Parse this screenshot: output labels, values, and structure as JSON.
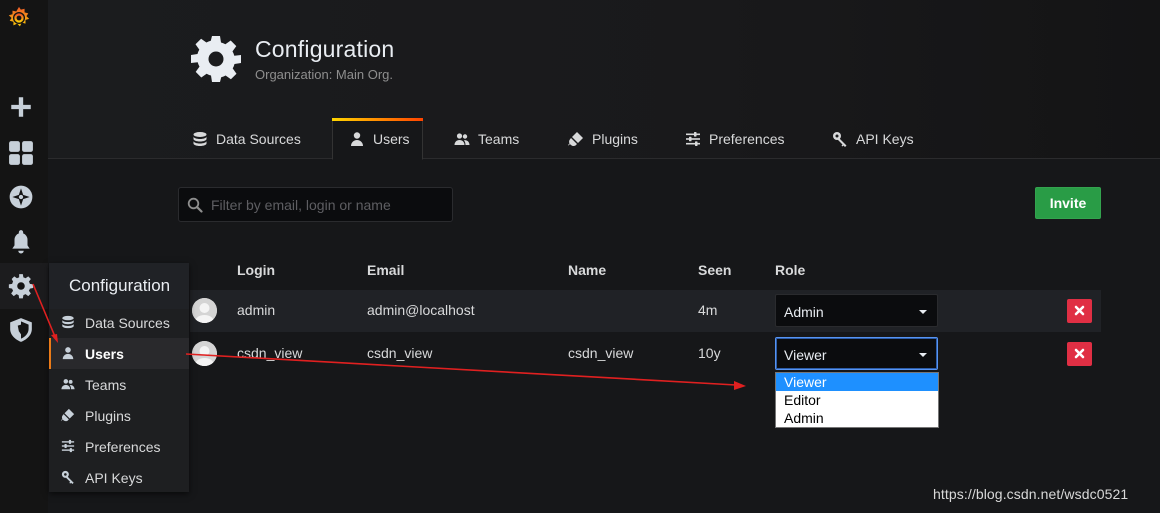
{
  "header": {
    "title": "Configuration",
    "subtitle": "Organization: Main Org."
  },
  "tabs": [
    {
      "label": "Data Sources",
      "icon": "database-icon",
      "active": false
    },
    {
      "label": "Users",
      "icon": "user-icon",
      "active": true
    },
    {
      "label": "Teams",
      "icon": "users-icon",
      "active": false
    },
    {
      "label": "Plugins",
      "icon": "plug-icon",
      "active": false
    },
    {
      "label": "Preferences",
      "icon": "sliders-icon",
      "active": false
    },
    {
      "label": "API Keys",
      "icon": "key-icon",
      "active": false
    }
  ],
  "search": {
    "placeholder": "Filter by email, login or name",
    "value": ""
  },
  "invite_label": "Invite",
  "table": {
    "headers": {
      "login": "Login",
      "email": "Email",
      "name": "Name",
      "seen": "Seen",
      "role": "Role"
    },
    "rows": [
      {
        "login": "admin",
        "email": "admin@localhost",
        "name": "",
        "seen": "4m",
        "role": "Admin"
      },
      {
        "login": "csdn_view",
        "email": "csdn_view",
        "name": "csdn_view",
        "seen": "10y",
        "role": "Viewer"
      }
    ]
  },
  "role_dropdown": {
    "open_for_row": 1,
    "options": [
      "Viewer",
      "Editor",
      "Admin"
    ],
    "highlighted": "Viewer"
  },
  "sidebar": {
    "icons": [
      "grafana-logo-icon",
      "plus-icon",
      "dashboards-icon",
      "explore-compass-icon",
      "bell-icon",
      "gear-icon",
      "shield-icon"
    ],
    "flyout": {
      "title": "Configuration",
      "items": [
        {
          "label": "Data Sources",
          "icon": "database-icon",
          "active": false
        },
        {
          "label": "Users",
          "icon": "user-icon",
          "active": true
        },
        {
          "label": "Teams",
          "icon": "users-icon",
          "active": false
        },
        {
          "label": "Plugins",
          "icon": "plug-icon",
          "active": false
        },
        {
          "label": "Preferences",
          "icon": "sliders-icon",
          "active": false
        },
        {
          "label": "API Keys",
          "icon": "key-icon",
          "active": false
        }
      ]
    }
  },
  "watermark": "https://blog.csdn.net/wsdc0521",
  "colors": {
    "background": "#161719",
    "accent_orange": "#eb7b18",
    "invite_green": "#299c46",
    "delete_red": "#e02f44",
    "annotation_red": "#e02020"
  }
}
